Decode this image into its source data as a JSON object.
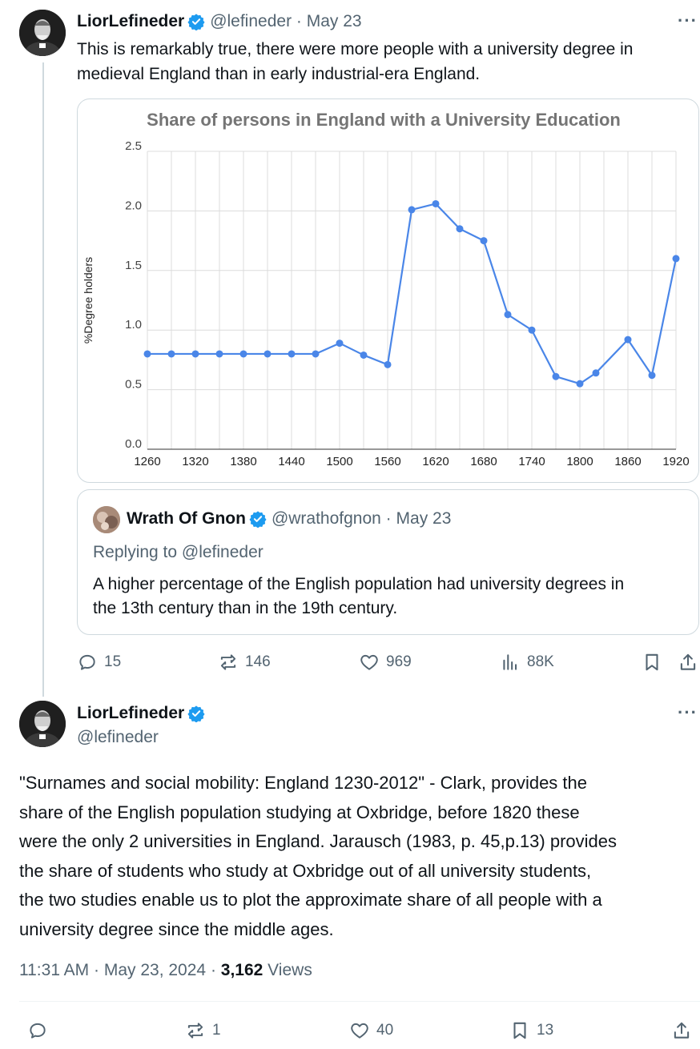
{
  "tweet1": {
    "display_name": "LiorLefineder",
    "handle": "@lefineder",
    "separator": " · ",
    "date": "May 23",
    "more": "···",
    "text": "This is remarkably true, there were more people with a university degree in medieval England than in early industrial-era England.",
    "text_lines": [
      "This is remarkably true, there were more people with a university degree in",
      "medieval England than in early industrial-era England."
    ],
    "actions": {
      "replies": "15",
      "reposts": "146",
      "likes": "969",
      "views": "88K"
    }
  },
  "quoted": {
    "display_name": "Wrath Of Gnon",
    "handle": "@wrathofgnon",
    "separator": " · ",
    "date": "May 23",
    "replying_to": "Replying to @lefineder",
    "text_lines": [
      "A higher percentage of the English population had university degrees in",
      "the 13th century than in the 19th century."
    ]
  },
  "tweet2": {
    "display_name": "LiorLefineder",
    "handle": "@lefineder",
    "more": "···",
    "text_lines": [
      "\"Surnames and social mobility: England 1230-2012\" - Clark, provides the",
      "share of the English population studying at Oxbridge, before 1820 these",
      "were the only 2 universities in England. Jarausch (1983, p. 45,p.13) provides",
      "the share of students who study at Oxbridge out of all university students,",
      "the two studies enable us to plot the approximate share of all people with a",
      "university degree since the middle ages."
    ],
    "time": "11:31 AM",
    "dot": " · ",
    "full_date": "May 23, 2024",
    "views_count": "3,162",
    "views_label": " Views",
    "actions": {
      "replies": "",
      "reposts": "1",
      "likes": "40",
      "bookmarks": "13"
    }
  },
  "colors": {
    "verified": "#1d9bf0",
    "line": "#4a86e8",
    "muted": "#536471",
    "title": "#757575"
  },
  "chart_data": {
    "type": "line",
    "title": "Share of persons in England with a University Education",
    "ylabel": "%Degree holders",
    "xlabel": "",
    "ylim": [
      0.0,
      2.5
    ],
    "xlim": [
      1260,
      1920
    ],
    "y_ticks": [
      "0.0",
      "0.5",
      "1.0",
      "1.5",
      "2.0",
      "2.5"
    ],
    "x_ticks": [
      "1260",
      "1320",
      "1380",
      "1440",
      "1500",
      "1560",
      "1620",
      "1680",
      "1740",
      "1800",
      "1860",
      "1920"
    ],
    "grid": true,
    "series": [
      {
        "x": [
          1260,
          1290,
          1320,
          1350,
          1380,
          1410,
          1440,
          1470,
          1500,
          1530,
          1560,
          1590,
          1620,
          1650,
          1680,
          1710,
          1740,
          1770,
          1800,
          1820,
          1860,
          1890,
          1920
        ],
        "values": [
          0.8,
          0.8,
          0.8,
          0.8,
          0.8,
          0.8,
          0.8,
          0.8,
          0.89,
          0.79,
          0.71,
          2.01,
          2.06,
          1.85,
          1.75,
          1.13,
          1.0,
          0.61,
          0.55,
          0.64,
          0.92,
          0.62,
          1.6
        ]
      }
    ]
  }
}
